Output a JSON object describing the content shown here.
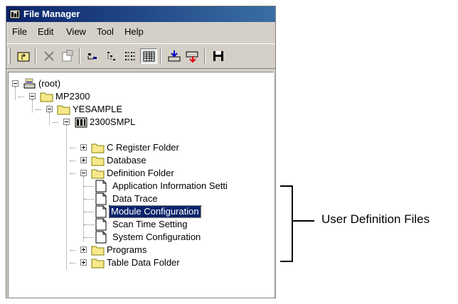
{
  "window": {
    "title": "File Manager"
  },
  "menu": [
    "File",
    "Edit",
    "View",
    "Tool",
    "Help"
  ],
  "toolbar": {
    "buttons": [
      "up-folder-icon",
      "delete-icon",
      "properties-icon",
      "large-icons-view-icon",
      "small-icons-view-icon",
      "list-view-icon",
      "details-view-icon",
      "import-icon",
      "export-icon",
      "save-icon"
    ],
    "pressed": "details-view-icon"
  },
  "tree": {
    "root": "(root)",
    "controller": "MP2300",
    "order_folder": "YESAMPLE",
    "pc_folder": "2300SMPL",
    "folders": {
      "c_register": "C Register Folder",
      "database": "Database",
      "definition": "Definition Folder",
      "programs": "Programs",
      "table_data": "Table Data Folder"
    },
    "definition_files": [
      "Application Information Setti",
      "Data Trace",
      "Module Configuration",
      "Scan Time Setting",
      "System Configuration"
    ],
    "selected": "Module Configuration"
  },
  "annotation": {
    "label": "User Definition Files"
  },
  "colors": {
    "title_bar": "#0a246a",
    "selection": "#0a246a",
    "folder": "#f8e88c"
  }
}
